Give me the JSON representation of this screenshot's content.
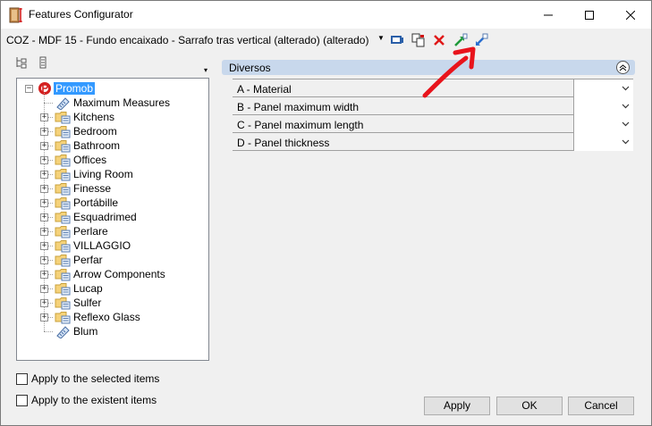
{
  "window": {
    "title": "Features Configurator",
    "controls": {
      "minimize": "—",
      "maximize": "☐",
      "close": "✕"
    }
  },
  "selection": {
    "current_item": "COZ - MDF 15 - Fundo encaixado - Sarrafo tras vertical (alterado) (alterado)",
    "icons": [
      "screen-icon",
      "copy-icon",
      "delete-icon",
      "export-icon",
      "import-icon"
    ]
  },
  "tree": {
    "tool_icons": [
      "collapse-tree-icon",
      "hierarchy-icon"
    ],
    "root": {
      "label": "Promob",
      "expander": "−"
    },
    "items": [
      {
        "label": "Maximum Measures",
        "icon": "measure-tag-icon",
        "expandable": false
      },
      {
        "label": "Kitchens",
        "icon": "folder-icon",
        "expandable": true
      },
      {
        "label": "Bedroom",
        "icon": "folder-icon",
        "expandable": true
      },
      {
        "label": "Bathroom",
        "icon": "folder-icon",
        "expandable": true
      },
      {
        "label": "Offices",
        "icon": "folder-icon",
        "expandable": true
      },
      {
        "label": "Living Room",
        "icon": "folder-icon",
        "expandable": true
      },
      {
        "label": "Finesse",
        "icon": "folder-icon",
        "expandable": true
      },
      {
        "label": "Portábille",
        "icon": "folder-icon",
        "expandable": true
      },
      {
        "label": "Esquadrimed",
        "icon": "folder-icon",
        "expandable": true
      },
      {
        "label": "Perlare",
        "icon": "folder-icon",
        "expandable": true
      },
      {
        "label": "VILLAGGIO",
        "icon": "folder-icon",
        "expandable": true
      },
      {
        "label": "Perfar",
        "icon": "folder-icon",
        "expandable": true
      },
      {
        "label": "Arrow Components",
        "icon": "folder-icon",
        "expandable": true
      },
      {
        "label": "Lucap",
        "icon": "folder-icon",
        "expandable": true
      },
      {
        "label": "Sulfer",
        "icon": "folder-icon",
        "expandable": true
      },
      {
        "label": "Reflexo Glass",
        "icon": "folder-icon",
        "expandable": true
      },
      {
        "label": "Blum",
        "icon": "measure-tag-icon",
        "expandable": false
      }
    ],
    "expander_plus": "+"
  },
  "options": {
    "apply_selected": "Apply to the selected items",
    "apply_existent": "Apply to the existent items"
  },
  "property_grid": {
    "group": "Diversos",
    "rows": [
      {
        "label": "A - Material",
        "value": ""
      },
      {
        "label": "B - Panel maximum width",
        "value": ""
      },
      {
        "label": "C - Panel maximum length",
        "value": ""
      },
      {
        "label": "D - Panel thickness",
        "value": ""
      }
    ]
  },
  "buttons": {
    "apply": "Apply",
    "ok": "OK",
    "cancel": "Cancel"
  },
  "colors": {
    "selection_highlight": "#3399ff",
    "group_header": "#c8d8ec",
    "annotation_arrow": "#e8141c"
  }
}
